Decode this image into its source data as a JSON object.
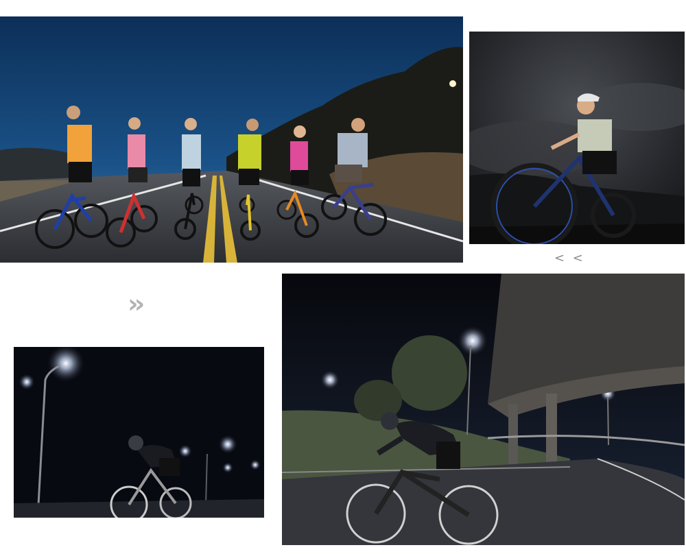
{
  "gallery": {
    "photos": [
      {
        "subject": "group-riders-dusk-road"
      },
      {
        "subject": "woman-cyclist-storm-sky"
      },
      {
        "subject": "cyclist-night-streetlights"
      },
      {
        "subject": "cyclist-under-overpass-night"
      }
    ],
    "arrow_left": "< <",
    "arrow_right": "››"
  },
  "colors": {
    "dusk_sky": "#0f3a66",
    "night_sky": "#080a12",
    "road": "#3a3d44",
    "lane_yellow": "#d8b33a",
    "streetlight": "#ffffff"
  }
}
